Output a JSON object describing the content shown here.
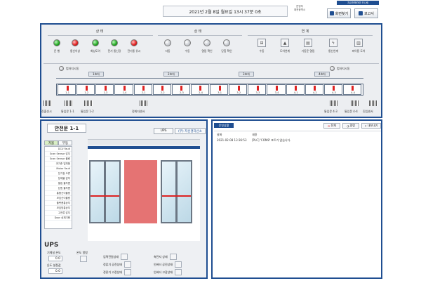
{
  "header": {
    "datetime": "2021년 2월 8일 월요일 13시 37분 0초",
    "small_info": [
      "운영자",
      "대전광역시"
    ],
    "top_link": "지금전해관련 모니링",
    "view_button": "화면찾기",
    "report_button": "보고서"
  },
  "status_groups": {
    "state_title": "상 태",
    "state_items": [
      "운 행",
      "통신이상",
      "화상도어",
      "전기 통신강",
      "전기통 유시"
    ],
    "status_title": "상 태",
    "status_items": [
      "자동",
      "수동",
      "열림 확인",
      "닫힘 확인"
    ],
    "link_title": "연 계",
    "link_items": [
      "수동",
      "도어연계",
      "기동운 열림",
      "통신연계",
      "파이용 도어"
    ]
  },
  "train": {
    "left_top": "범저지시동",
    "right_top": "범저지시동",
    "cars": [
      "1호차",
      "2호차",
      "3호차",
      "4호차"
    ],
    "left_bottom": "진출선시",
    "car_door_labels": [
      "통입문 1-1",
      "통입문 1-2"
    ],
    "center_bottom": "정최지센서",
    "right_door_labels": [
      "통입문 4-3",
      "통입문 4-4"
    ],
    "right_bottom": "진입센서",
    "door_codes": [
      "1-1",
      "1-2",
      "1-3",
      "1-4",
      "2-1",
      "2-2",
      "2-3",
      "2-4",
      "3-1",
      "3-2",
      "3-3",
      "3-4",
      "4-1",
      "4-2",
      "4-3",
      "4-4"
    ]
  },
  "door_panel": {
    "title": "안전문 1-1",
    "ups_btn": "UPS",
    "sensor_btn": "(부) 저선경차선소",
    "fault_tabs": [
      "저울",
      "부동"
    ],
    "faults": [
      "DCU Fault",
      "Scan Sensor 감지",
      "Scan Sensor 불량",
      "과기준 일피품",
      "Motor Fault",
      "전기정 오류",
      "장애물 감지",
      "열림 물차름",
      "닫힘 물차름",
      "통합신이불량",
      "모임신이불량",
      "플랫폼통상지",
      "모임방통상지",
      "고전류 감지",
      "Door 상체기왕"
    ],
    "ups_label": "UPS",
    "ups_left": [
      "기계실 온도",
      "온도 설정값"
    ],
    "ups_left_values": [
      "0.0",
      "0.0"
    ],
    "ups_mid": "온도 알람",
    "ups_indicators_left": [
      "입력전원상태",
      "정류기 공진상태",
      "정류기 고장상태"
    ],
    "ups_indicators_right": [
      "축전지 상태",
      "인버터 공진상태",
      "인버터 고장상태"
    ]
  },
  "log_panel": {
    "tab": "운영상황",
    "btn_all": "전체",
    "btn_confirm": "알람",
    "btn_export": "내보내기",
    "col_date": "날짜",
    "col_content": "내용",
    "rows": [
      {
        "date": "2021-02-08 13:36:53",
        "content": "[PLC] 'COM8' 포트가 없습니다."
      }
    ]
  },
  "colors": {
    "frame_blue": "#1f4e91",
    "door_red": "#e57373",
    "lamp_green": "#20a520",
    "lamp_red": "#e01b1b"
  }
}
